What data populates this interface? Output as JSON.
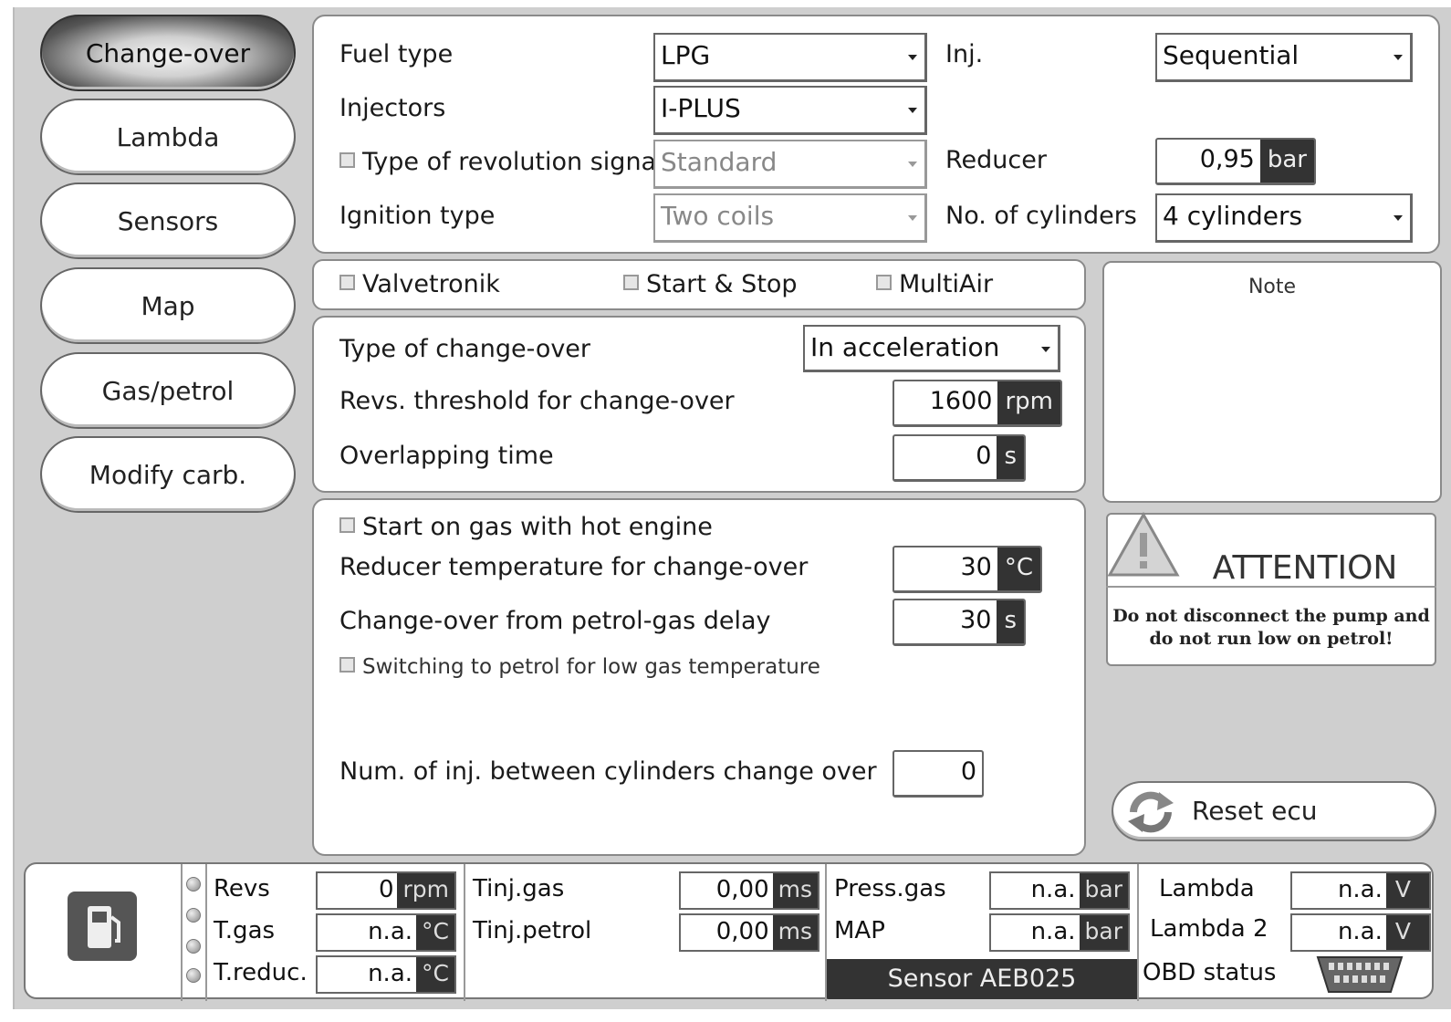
{
  "nav": {
    "items": [
      "Change-over",
      "Lambda",
      "Sensors",
      "Map",
      "Gas/petrol",
      "Modify carb."
    ],
    "active": "Change-over"
  },
  "config": {
    "fuel_type_label": "Fuel type",
    "fuel_type_value": "LPG",
    "inj_label": "Inj.",
    "inj_value": "Sequential",
    "injectors_label": "Injectors",
    "injectors_value": "I-PLUS",
    "rev_signal_label": "Type of revolution signal",
    "rev_signal_value": "Standard",
    "reducer_label": "Reducer",
    "reducer_value": "0,95",
    "reducer_unit": "bar",
    "ignition_label": "Ignition type",
    "ignition_value": "Two coils",
    "cylinders_label": "No. of cylinders",
    "cylinders_value": "4 cylinders"
  },
  "options": {
    "valvetronik": "Valvetronik",
    "start_stop": "Start & Stop",
    "multiair": "MultiAir"
  },
  "note": {
    "title": "Note"
  },
  "changeover": {
    "type_label": "Type of change-over",
    "type_value": "In acceleration",
    "revs_label": "Revs. threshold for change-over",
    "revs_value": "1600",
    "revs_unit": "rpm",
    "overlap_label": "Overlapping time",
    "overlap_value": "0",
    "overlap_unit": "s"
  },
  "gasstart": {
    "hot_engine_label": "Start on gas with hot engine",
    "reducer_temp_label": "Reducer temperature for change-over",
    "reducer_temp_value": "30",
    "reducer_temp_unit": "°C",
    "delay_label": "Change-over from petrol-gas delay",
    "delay_value": "30",
    "delay_unit": "s",
    "low_temp_label": "Switching to petrol for low gas temperature",
    "num_inj_label": "Num. of inj. between cylinders change over",
    "num_inj_value": "0"
  },
  "attention": {
    "title": "ATTENTION",
    "line1": "Do not disconnect the pump and",
    "line2": "do not run low on petrol!"
  },
  "reset": {
    "label": "Reset ecu"
  },
  "status": {
    "revs_label": "Revs",
    "revs_value": "0",
    "revs_unit": "rpm",
    "tgas_label": "T.gas",
    "tgas_value": "n.a.",
    "tgas_unit": "°C",
    "treduc_label": "T.reduc.",
    "treduc_value": "n.a.",
    "treduc_unit": "°C",
    "tinj_gas_label": "Tinj.gas",
    "tinj_gas_value": "0,00",
    "tinj_gas_unit": "ms",
    "tinj_petrol_label": "Tinj.petrol",
    "tinj_petrol_value": "0,00",
    "tinj_petrol_unit": "ms",
    "press_gas_label": "Press.gas",
    "press_gas_value": "n.a.",
    "press_gas_unit": "bar",
    "map_label": "MAP",
    "map_value": "n.a.",
    "map_unit": "bar",
    "sensor_label": "Sensor AEB025",
    "lambda_label": "Lambda",
    "lambda_value": "n.a.",
    "lambda_unit": "V",
    "lambda2_label": "Lambda 2",
    "lambda2_value": "n.a.",
    "lambda2_unit": "V",
    "obd_label": "OBD status"
  }
}
